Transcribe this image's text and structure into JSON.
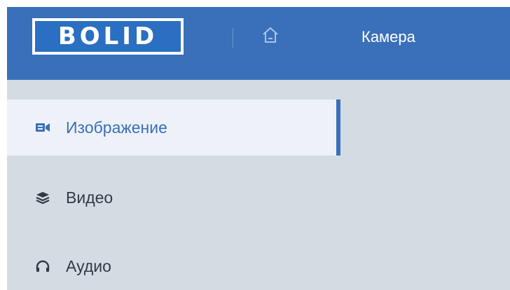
{
  "header": {
    "logo_text": "BOLID",
    "title": "Камера",
    "home_icon": "home-icon"
  },
  "sidebar": {
    "items": [
      {
        "label": "Изображение",
        "icon": "camera-icon",
        "active": true
      },
      {
        "label": "Видео",
        "icon": "layers-icon",
        "active": false
      },
      {
        "label": "Аудио",
        "icon": "headphones-icon",
        "active": false
      }
    ]
  },
  "colors": {
    "header_bg": "#3a6fba",
    "content_bg": "#d5dbe2",
    "active_item_bg": "#eef2f8",
    "accent": "#3a6fba"
  }
}
